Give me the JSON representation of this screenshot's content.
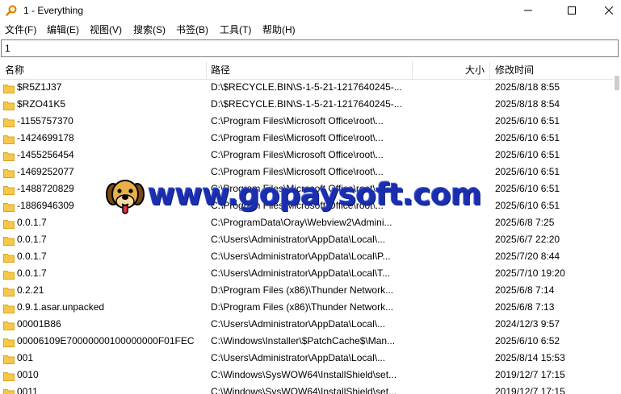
{
  "window": {
    "title": "1 - Everything",
    "icon": "magnifier-icon"
  },
  "menu": [
    {
      "label": "文件(F)"
    },
    {
      "label": "编辑(E)"
    },
    {
      "label": "视图(V)"
    },
    {
      "label": "搜索(S)"
    },
    {
      "label": "书签(B)"
    },
    {
      "label": "工具(T)"
    },
    {
      "label": "帮助(H)"
    }
  ],
  "search": {
    "value": "1"
  },
  "columns": {
    "name": "名称",
    "path": "路径",
    "size": "大小",
    "modified": "修改时间"
  },
  "rows": [
    {
      "name": "$R5Z1J37",
      "path": "D:\\$RECYCLE.BIN\\S-1-5-21-1217640245-...",
      "size": "",
      "modified": "2025/8/18 8:55"
    },
    {
      "name": "$RZO41K5",
      "path": "D:\\$RECYCLE.BIN\\S-1-5-21-1217640245-...",
      "size": "",
      "modified": "2025/8/18 8:54"
    },
    {
      "name": "-1155757370",
      "path": "C:\\Program Files\\Microsoft Office\\root\\...",
      "size": "",
      "modified": "2025/6/10 6:51"
    },
    {
      "name": "-1424699178",
      "path": "C:\\Program Files\\Microsoft Office\\root\\...",
      "size": "",
      "modified": "2025/6/10 6:51"
    },
    {
      "name": "-1455256454",
      "path": "C:\\Program Files\\Microsoft Office\\root\\...",
      "size": "",
      "modified": "2025/6/10 6:51"
    },
    {
      "name": "-1469252077",
      "path": "C:\\Program Files\\Microsoft Office\\root\\...",
      "size": "",
      "modified": "2025/6/10 6:51"
    },
    {
      "name": "-1488720829",
      "path": "C:\\Program Files\\Microsoft Office\\root\\...",
      "size": "",
      "modified": "2025/6/10 6:51"
    },
    {
      "name": "-1886946309",
      "path": "C:\\Program Files\\Microsoft Office\\root\\...",
      "size": "",
      "modified": "2025/6/10 6:51"
    },
    {
      "name": "0.0.1.7",
      "path": "C:\\ProgramData\\Oray\\Webview2\\Admini...",
      "size": "",
      "modified": "2025/6/8 7:25"
    },
    {
      "name": "0.0.1.7",
      "path": "C:\\Users\\Administrator\\AppData\\Local\\...",
      "size": "",
      "modified": "2025/6/7 22:20"
    },
    {
      "name": "0.0.1.7",
      "path": "C:\\Users\\Administrator\\AppData\\Local\\P...",
      "size": "",
      "modified": "2025/7/20 8:44"
    },
    {
      "name": "0.0.1.7",
      "path": "C:\\Users\\Administrator\\AppData\\Local\\T...",
      "size": "",
      "modified": "2025/7/10 19:20"
    },
    {
      "name": "0.2.21",
      "path": "D:\\Program Files (x86)\\Thunder Network...",
      "size": "",
      "modified": "2025/6/8 7:14"
    },
    {
      "name": "0.9.1.asar.unpacked",
      "path": "D:\\Program Files (x86)\\Thunder Network...",
      "size": "",
      "modified": "2025/6/8 7:13"
    },
    {
      "name": "00001B86",
      "path": "C:\\Users\\Administrator\\AppData\\Local\\...",
      "size": "",
      "modified": "2024/12/3 9:57"
    },
    {
      "name": "00006109E70000000100000000F01FEC",
      "path": "C:\\Windows\\Installer\\$PatchCache$\\Man...",
      "size": "",
      "modified": "2025/6/10 6:52"
    },
    {
      "name": "001",
      "path": "C:\\Users\\Administrator\\AppData\\Local\\...",
      "size": "",
      "modified": "2025/8/14 15:53"
    },
    {
      "name": "0010",
      "path": "C:\\Windows\\SysWOW64\\InstallShield\\set...",
      "size": "",
      "modified": "2019/12/7 17:15"
    },
    {
      "name": "0011",
      "path": "C:\\Windows\\SysWOW64\\InstallShield\\set...",
      "size": "",
      "modified": "2019/12/7 17:15"
    }
  ],
  "watermark": {
    "text": "www.gopaysoft.com",
    "icon": "dog-face-icon"
  },
  "colors": {
    "folder": "#f5c84c",
    "watermark": "#1b2fae"
  }
}
